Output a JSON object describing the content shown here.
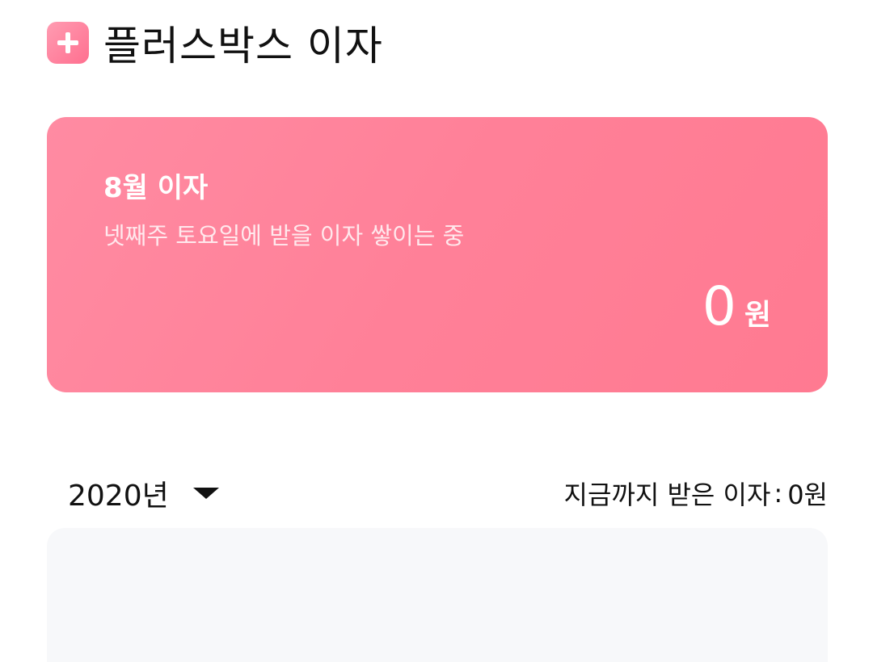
{
  "header": {
    "icon": "plus-icon",
    "title": "플러스박스 이자"
  },
  "card": {
    "title": "8월 이자",
    "subtitle": "넷째주 토요일에 받을 이자 쌓이는 중",
    "amount_value": "0",
    "amount_unit": "원",
    "colors": {
      "gradient_start": "#ff8ba2",
      "gradient_end": "#ff7a91"
    }
  },
  "year_selector": {
    "label": "2020년",
    "icon": "caret-down-icon"
  },
  "total_interest": {
    "label": "지금까지 받은 이자",
    "separator": ":",
    "value": "0원"
  }
}
